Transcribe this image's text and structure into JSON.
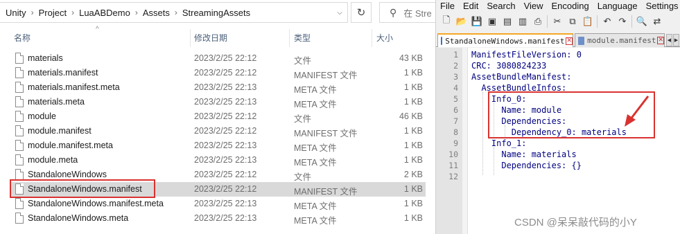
{
  "explorer": {
    "breadcrumbs": [
      "Unity",
      "Project",
      "LuaABDemo",
      "Assets",
      "StreamingAssets"
    ],
    "search_placeholder": "在 Stre",
    "columns": {
      "name": "名称",
      "date": "修改日期",
      "type": "类型",
      "size": "大小"
    },
    "files": [
      {
        "name": "materials",
        "date": "2023/2/25 22:12",
        "type": "文件",
        "size": "43 KB"
      },
      {
        "name": "materials.manifest",
        "date": "2023/2/25 22:12",
        "type": "MANIFEST 文件",
        "size": "1 KB"
      },
      {
        "name": "materials.manifest.meta",
        "date": "2023/2/25 22:13",
        "type": "META 文件",
        "size": "1 KB"
      },
      {
        "name": "materials.meta",
        "date": "2023/2/25 22:13",
        "type": "META 文件",
        "size": "1 KB"
      },
      {
        "name": "module",
        "date": "2023/2/25 22:12",
        "type": "文件",
        "size": "46 KB"
      },
      {
        "name": "module.manifest",
        "date": "2023/2/25 22:12",
        "type": "MANIFEST 文件",
        "size": "1 KB"
      },
      {
        "name": "module.manifest.meta",
        "date": "2023/2/25 22:13",
        "type": "META 文件",
        "size": "1 KB"
      },
      {
        "name": "module.meta",
        "date": "2023/2/25 22:13",
        "type": "META 文件",
        "size": "1 KB"
      },
      {
        "name": "StandaloneWindows",
        "date": "2023/2/25 22:12",
        "type": "文件",
        "size": "2 KB"
      },
      {
        "name": "StandaloneWindows.manifest",
        "date": "2023/2/25 22:12",
        "type": "MANIFEST 文件",
        "size": "1 KB"
      },
      {
        "name": "StandaloneWindows.manifest.meta",
        "date": "2023/2/25 22:13",
        "type": "META 文件",
        "size": "1 KB"
      },
      {
        "name": "StandaloneWindows.meta",
        "date": "2023/2/25 22:13",
        "type": "META 文件",
        "size": "1 KB"
      }
    ]
  },
  "notepad": {
    "menu": [
      "File",
      "Edit",
      "Search",
      "View",
      "Encoding",
      "Language",
      "Settings"
    ],
    "tabs": [
      {
        "label": "StandaloneWindows.manifest",
        "active": true
      },
      {
        "label": "module.manifest",
        "active": false
      }
    ],
    "lines": [
      {
        "num": "1",
        "text": "ManifestFileVersion: 0"
      },
      {
        "num": "2",
        "text": "CRC: 3080824233"
      },
      {
        "num": "3",
        "text": "AssetBundleManifest:"
      },
      {
        "num": "4",
        "text": "  AssetBundleInfos:"
      },
      {
        "num": "5",
        "text": "    Info_0:"
      },
      {
        "num": "6",
        "text": "      Name: module"
      },
      {
        "num": "7",
        "text": "      Dependencies:"
      },
      {
        "num": "8",
        "text": "        Dependency_0: materials"
      },
      {
        "num": "9",
        "text": "    Info_1:"
      },
      {
        "num": "10",
        "text": "      Name: materials"
      },
      {
        "num": "11",
        "text": "      Dependencies: {}"
      },
      {
        "num": "12",
        "text": ""
      }
    ]
  },
  "watermark": "CSDN @呆呆敲代码的小Y",
  "colors": {
    "highlight_red": "#d9322f",
    "selected_row": "#d9d9d9",
    "code_text": "#000080"
  }
}
